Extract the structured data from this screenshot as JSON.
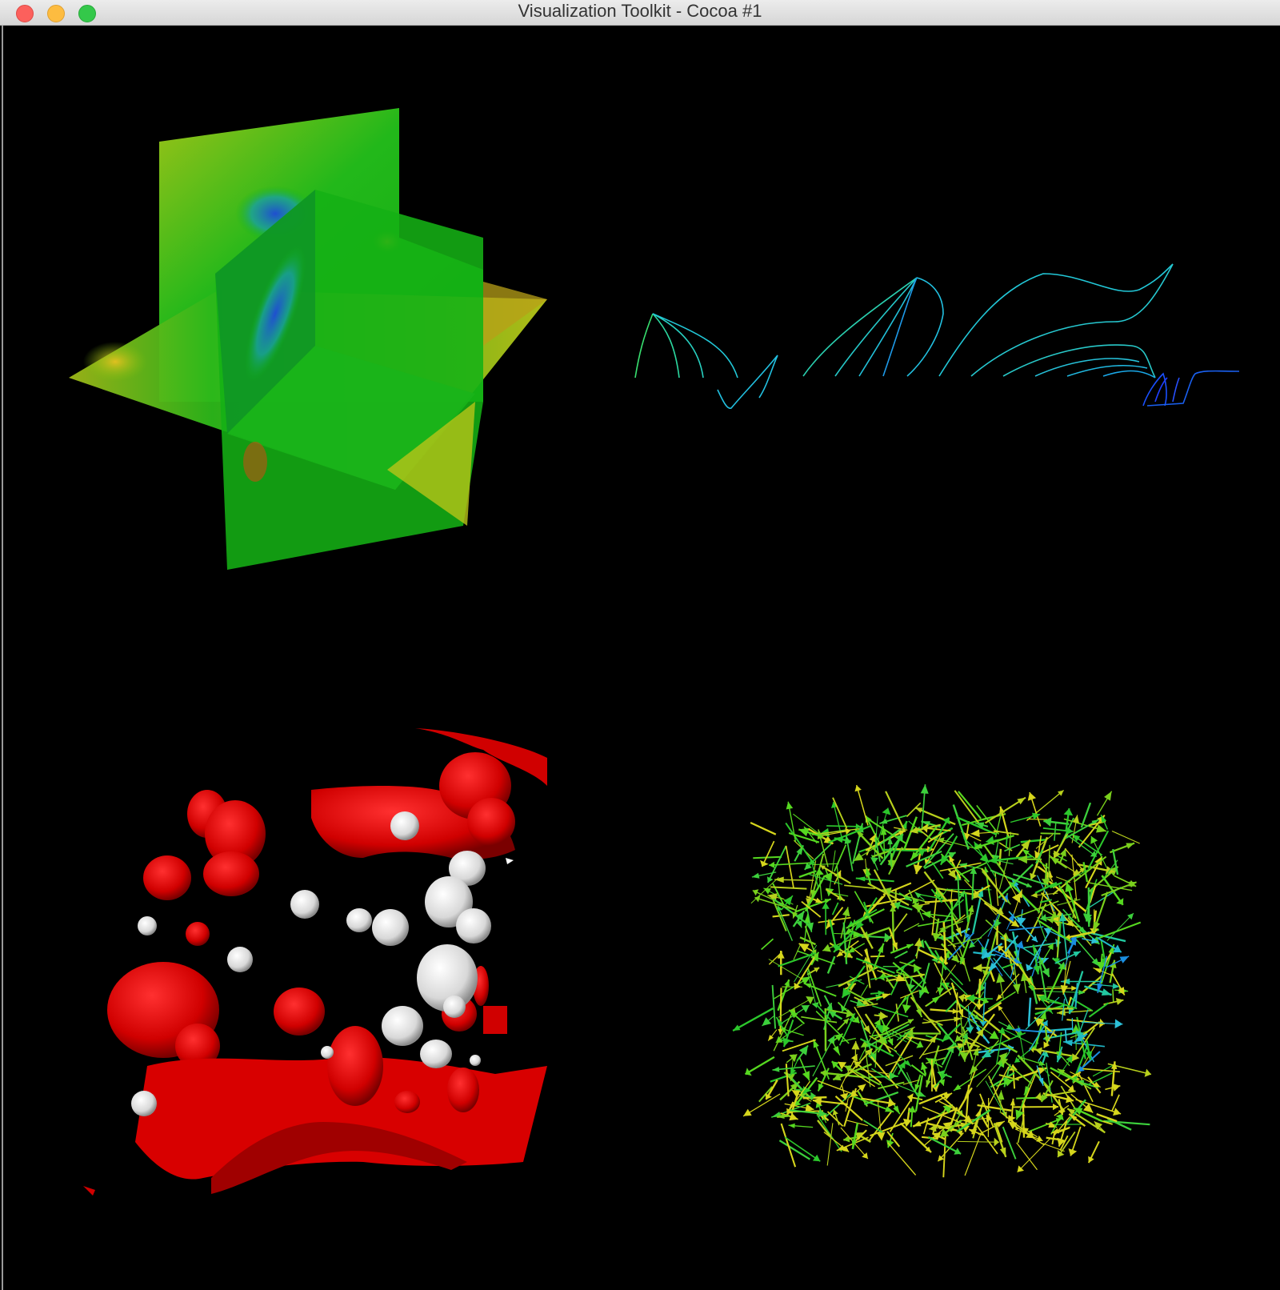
{
  "window": {
    "title": "Visualization Toolkit - Cocoa #1"
  },
  "colors": {
    "background": "#000000",
    "plane_green": "#11b411",
    "streamline_cyan": "#22d6d6",
    "streamline_blue": "#1a3cff",
    "isosurface_red": "#e00000",
    "sphere_white": "#e6e6e6",
    "glyph_green": "#3cd03c",
    "glyph_yellow": "#d6d61c"
  },
  "renderers": [
    {
      "id": "renderer-top-left",
      "content": "cut-planes"
    },
    {
      "id": "renderer-top-right",
      "content": "streamlines"
    },
    {
      "id": "renderer-bottom-left",
      "content": "isosurfaces"
    },
    {
      "id": "renderer-bottom-right",
      "content": "vector-glyphs"
    }
  ]
}
